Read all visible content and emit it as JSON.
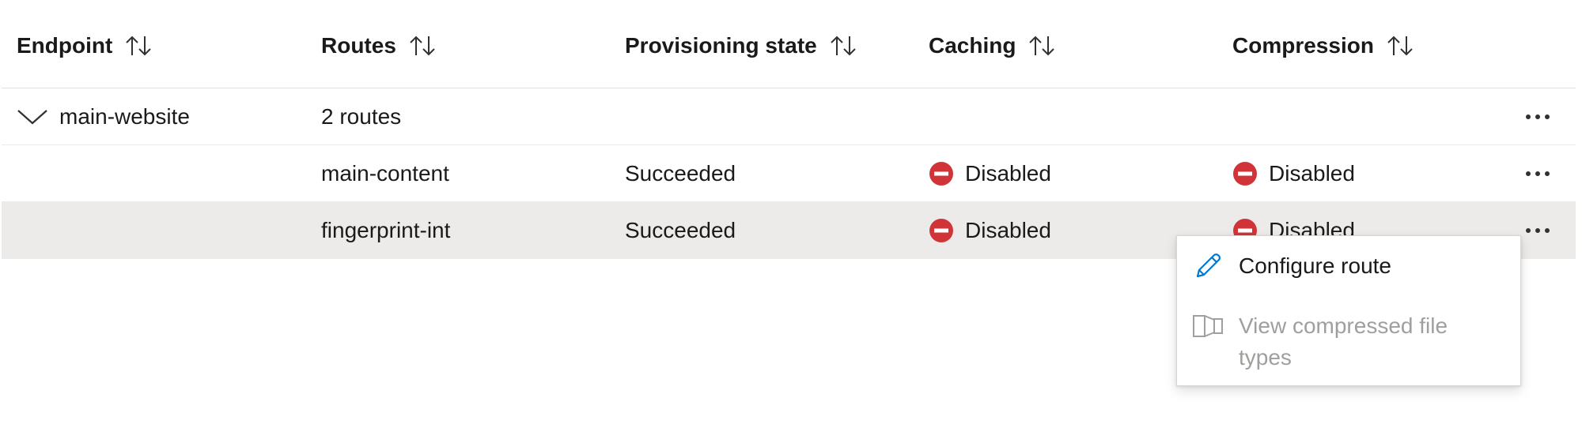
{
  "table": {
    "columns": [
      {
        "label": "Endpoint"
      },
      {
        "label": "Routes"
      },
      {
        "label": "Provisioning state"
      },
      {
        "label": "Caching"
      },
      {
        "label": "Compression"
      }
    ],
    "group": {
      "endpoint": "main-website",
      "routes_count": "2 routes",
      "expanded": true
    },
    "rows": [
      {
        "route": "main-content",
        "provisioning": "Succeeded",
        "caching": "Disabled",
        "compression": "Disabled",
        "selected": false
      },
      {
        "route": "fingerprint-int",
        "provisioning": "Succeeded",
        "caching": "Disabled",
        "compression": "Disabled",
        "selected": true
      }
    ]
  },
  "context_menu": {
    "items": [
      {
        "label": "Configure route",
        "icon": "pencil-icon",
        "enabled": true
      },
      {
        "label": "View compressed file types",
        "icon": "compressed-files-icon",
        "enabled": false
      }
    ]
  },
  "colors": {
    "disabled_status": "#d13438",
    "accent": "#0078d4",
    "selected_row": "#edebe9"
  }
}
